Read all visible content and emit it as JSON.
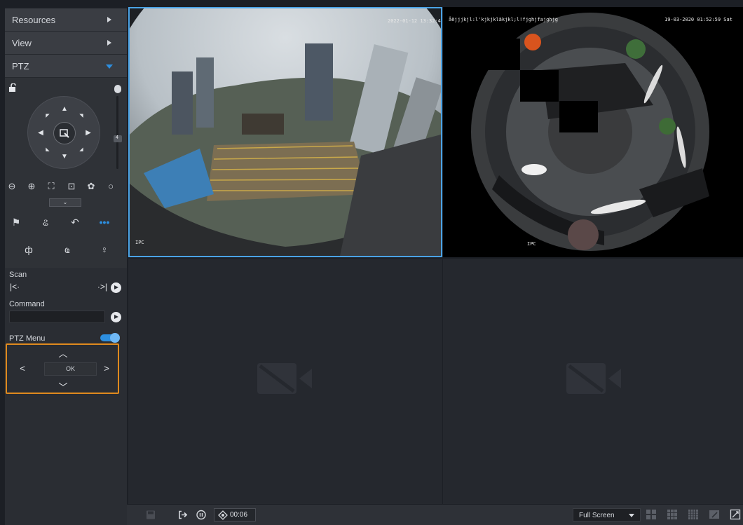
{
  "sidebar": {
    "resources_label": "Resources",
    "view_label": "View",
    "ptz_label": "PTZ",
    "zoom_value": "4",
    "scan_label": "Scan",
    "command_label": "Command",
    "command_value": "",
    "ptz_menu_label": "PTZ Menu",
    "ptz_menu_ok": "OK",
    "more_label": "•••"
  },
  "cameras": [
    {
      "osd_top_right": "2022-01-12 13:32:45",
      "osd_bottom_left": "IPC"
    },
    {
      "osd_top_left": "åëjjjkjl:l'kjkjkläkjkl;l!fjghjfajghjg",
      "osd_top_right": "19-03-2020 01:52:59 Sat",
      "osd_bottom_left": "IPC"
    }
  ],
  "toolbar": {
    "timer": "00:06",
    "layout_select": "Full Screen"
  },
  "colors": {
    "accent": "#2d8fe0",
    "highlight": "#e08a1e",
    "selection": "#4aa3e6"
  }
}
